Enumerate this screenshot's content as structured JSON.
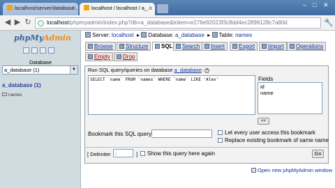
{
  "browser": {
    "tabs": [
      {
        "label": "localhost/server/database..."
      },
      {
        "label": "localhost / localhost / a_..."
      }
    ],
    "url_host": "localhost",
    "url_rest": "/phpmyadmin/index.php?db=a_database&token=e276e92023f3c8dd4ec2896128c7a80d"
  },
  "left": {
    "logo_php": "php",
    "logo_my": "My",
    "logo_admin": "Admin",
    "db_label": "Database",
    "db_selected": "a_database (1)",
    "db_heading": "a_database (1)",
    "tables": [
      "names"
    ]
  },
  "breadcrumb": {
    "server_label": "Server:",
    "server_value": "localhost",
    "database_label": "Database:",
    "database_value": "a_database",
    "table_label": "Table:",
    "table_value": "names"
  },
  "tabs": [
    "Browse",
    "Structure",
    "SQL",
    "Search",
    "Insert",
    "Export",
    "Import",
    "Operations",
    "Empty",
    "Drop"
  ],
  "sql": {
    "legend_prefix": "Run SQL query/queries on database",
    "legend_db": "a_database",
    "legend_suffix": ":",
    "query": "SELECT `name` FROM `names` WHERE `name` LIKE 'Alex'",
    "fields_label": "Fields",
    "fields": [
      "id",
      "name"
    ],
    "insert_button": "<<",
    "bookmark_label": "Bookmark this SQL query:",
    "bookmark_value": "",
    "let_every_user": "Let every user access this bookmark",
    "replace_bookmark": "Replace existing bookmark of same name",
    "delimiter_label": "[ Delimiter",
    "delimiter_value": ";",
    "delimiter_close": "]",
    "show_query_label": "Show this query here again",
    "go_button": "Go"
  },
  "footer": {
    "new_window": "Open new phpMyAdmin window"
  }
}
